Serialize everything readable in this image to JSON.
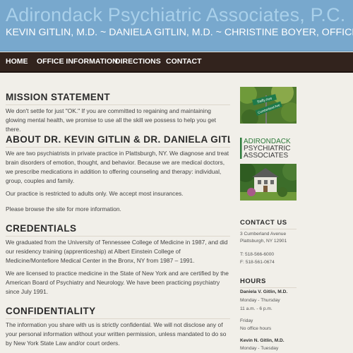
{
  "header": {
    "title": "Adirondack Psychiatric Associates, P.C.",
    "subtitle": "KEVIN GITLIN, M.D. ~ DANIELA GITLIN, M.D. ~ CHRISTINE BOYER, OFFICE MANAGER"
  },
  "nav": {
    "items": [
      {
        "label": "HOME"
      },
      {
        "label": "OFFICE INFORMATION"
      },
      {
        "label": "DIRECTIONS"
      },
      {
        "label": "CONTACT"
      }
    ]
  },
  "main": {
    "mission": {
      "heading": "MISSION STATEMENT",
      "text": "We don't settle for just \"OK.\" If you are committed to regaining and maintaining glowing mental health, we promise to use all the skill we possess to help you get there."
    },
    "about": {
      "heading": "ABOUT DR. KEVIN GITLIN & DR. DANIELA GITLIN",
      "p1": "We are two psychiatrists in private practice in Plattsburgh, NY. We diagnose and treat brain disorders of emotion, thought, and behavior. Because we are medical doctors, we prescribe medications in addition to offering counseling and therapy: individual, group, couples and family.",
      "p2": "Our practice is restricted to adults only. We accept most insurances.",
      "p3": "Please browse the site for more information."
    },
    "credentials": {
      "heading": "CREDENTIALS",
      "p1": "We graduated from the University of Tennessee College of Medicine in 1987, and did our residency training (apprenticeship) at Albert Einstein College of Medicine/Montefiore Medical Center in the Bronx, NY from 1987 – 1991.",
      "p2": "We are licensed to practice medicine in the State of New York and are certified by the American Board of Psychiatry and Neurology. We have been practicing psychiatry since July 1991."
    },
    "confidentiality": {
      "heading": "CONFIDENTIALITY",
      "p1": "The information you share with us is strictly confidential. We will not disclose any of your personal information without your written permission, unless mandated to do so by New York State Law and/or court orders."
    }
  },
  "sidebar": {
    "sign_text_1": "Sailly Ave",
    "sign_text_2": "Cumberland Ave",
    "logo": {
      "line1": "ADIRONDACK",
      "line2": "PSYCHIATRIC",
      "line3": "ASSOCIATES"
    },
    "contact": {
      "heading": "CONTACT US",
      "address1": "3 Cumberland Avenue",
      "address2": "Plattsburgh, NY 12901",
      "phone": "T: 518-566-6000",
      "fax": "F: 518-561-0674"
    },
    "hours": {
      "heading": "HOURS",
      "name1": "Daniela V. Gitlin, M.D.",
      "days1": "Monday - Thursday",
      "time1": "11 a.m. - 6 p.m.",
      "day1b": "Friday",
      "note1b": "No office hours",
      "name2": "Kevin N. Gitlin, M.D.",
      "days2": "Monday - Tuesday"
    }
  },
  "colors": {
    "header_bg": "#78a8cd",
    "title": "#a9d0ea",
    "nav_bg": "#32231d",
    "page_bg": "#f1efe9",
    "logo_green": "#2d7a3a"
  }
}
